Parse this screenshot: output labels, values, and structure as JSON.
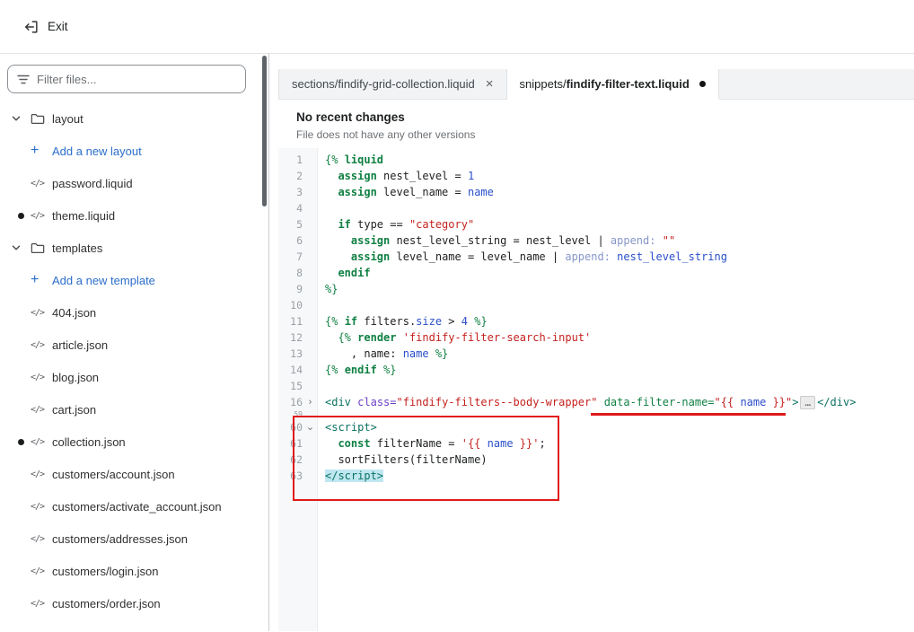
{
  "topbar": {
    "exit_label": "Exit"
  },
  "icons": {
    "close": "×",
    "unsaved_dot": "●",
    "add_plus": "+",
    "code_file": "</>",
    "fold_collapsed": "›",
    "fold_expanded": "⌄"
  },
  "sidebar": {
    "filter_placeholder": "Filter files...",
    "tree": [
      {
        "type": "folder",
        "label": "layout",
        "expanded": true
      },
      {
        "type": "add",
        "label": "Add a new layout"
      },
      {
        "type": "file",
        "label": "password.liquid",
        "modified": false
      },
      {
        "type": "file",
        "label": "theme.liquid",
        "modified": true
      },
      {
        "type": "folder",
        "label": "templates",
        "expanded": true
      },
      {
        "type": "add",
        "label": "Add a new template"
      },
      {
        "type": "file",
        "label": "404.json",
        "modified": false
      },
      {
        "type": "file",
        "label": "article.json",
        "modified": false
      },
      {
        "type": "file",
        "label": "blog.json",
        "modified": false
      },
      {
        "type": "file",
        "label": "cart.json",
        "modified": false
      },
      {
        "type": "file",
        "label": "collection.json",
        "modified": true
      },
      {
        "type": "file",
        "label": "customers/account.json",
        "modified": false
      },
      {
        "type": "file",
        "label": "customers/activate_account.json",
        "modified": false
      },
      {
        "type": "file",
        "label": "customers/addresses.json",
        "modified": false
      },
      {
        "type": "file",
        "label": "customers/login.json",
        "modified": false
      },
      {
        "type": "file",
        "label": "customers/order.json",
        "modified": false
      }
    ]
  },
  "tabs": [
    {
      "prefix": "sections/",
      "name": "findify-grid-collection.liquid",
      "active": false,
      "closeable": true,
      "dirty": false
    },
    {
      "prefix": "snippets/",
      "name": "findify-filter-text.liquid",
      "active": true,
      "closeable": false,
      "dirty": true
    }
  ],
  "editor": {
    "status_title": "No recent changes",
    "status_subtitle": "File does not have any other versions",
    "lines": [
      {
        "n": 1,
        "tokens": [
          [
            "g",
            "{% "
          ],
          [
            "kw",
            "liquid"
          ]
        ]
      },
      {
        "n": 2,
        "tokens": [
          [
            "p",
            "  "
          ],
          [
            "kw",
            "assign"
          ],
          [
            "p",
            " nest_level = "
          ],
          [
            "b",
            "1"
          ]
        ]
      },
      {
        "n": 3,
        "tokens": [
          [
            "p",
            "  "
          ],
          [
            "kw",
            "assign"
          ],
          [
            "p",
            " level_name = "
          ],
          [
            "b",
            "name"
          ]
        ]
      },
      {
        "n": 4,
        "tokens": []
      },
      {
        "n": 5,
        "tokens": [
          [
            "p",
            "  "
          ],
          [
            "kw",
            "if"
          ],
          [
            "p",
            " type == "
          ],
          [
            "s",
            "\"category\""
          ]
        ]
      },
      {
        "n": 6,
        "tokens": [
          [
            "p",
            "    "
          ],
          [
            "kw",
            "assign"
          ],
          [
            "p",
            " nest_level_string = nest_level | "
          ],
          [
            "f",
            "append:"
          ],
          [
            "p",
            " "
          ],
          [
            "s",
            "\"\""
          ]
        ]
      },
      {
        "n": 7,
        "tokens": [
          [
            "p",
            "    "
          ],
          [
            "kw",
            "assign"
          ],
          [
            "p",
            " level_name = level_name | "
          ],
          [
            "f",
            "append:"
          ],
          [
            "p",
            " "
          ],
          [
            "b",
            "nest_level_string"
          ]
        ]
      },
      {
        "n": 8,
        "tokens": [
          [
            "p",
            "  "
          ],
          [
            "kw",
            "endif"
          ]
        ]
      },
      {
        "n": 9,
        "tokens": [
          [
            "g",
            "%}"
          ]
        ]
      },
      {
        "n": 10,
        "tokens": []
      },
      {
        "n": 11,
        "tokens": [
          [
            "g",
            "{% "
          ],
          [
            "kw",
            "if"
          ],
          [
            "p",
            " filters."
          ],
          [
            "b",
            "size"
          ],
          [
            "p",
            " > "
          ],
          [
            "b",
            "4"
          ],
          [
            "g",
            " %}"
          ]
        ]
      },
      {
        "n": 12,
        "tokens": [
          [
            "p",
            "  "
          ],
          [
            "g",
            "{% "
          ],
          [
            "kw",
            "render"
          ],
          [
            "p",
            " "
          ],
          [
            "s",
            "'findify-filter-search-input'"
          ]
        ]
      },
      {
        "n": 13,
        "tokens": [
          [
            "p",
            "    , name: "
          ],
          [
            "b",
            "name"
          ],
          [
            "g",
            " %}"
          ]
        ]
      },
      {
        "n": 14,
        "tokens": [
          [
            "g",
            "{% "
          ],
          [
            "kw",
            "endif"
          ],
          [
            "g",
            " %}"
          ]
        ]
      },
      {
        "n": 15,
        "tokens": []
      },
      {
        "n": 16,
        "fold": "collapsed",
        "tokens": [
          [
            "tag",
            "<div"
          ],
          [
            "p",
            " "
          ],
          [
            "ap",
            "class="
          ],
          [
            "s",
            "\"findify-filters--body-wrapper\""
          ],
          [
            "p",
            " "
          ],
          [
            "ag",
            "data-filter-name="
          ],
          [
            "s",
            "\"{{ "
          ],
          [
            "b",
            "name"
          ],
          [
            "s",
            " }}\""
          ],
          [
            "tag",
            ">"
          ],
          [
            "fold",
            "…"
          ],
          [
            "tag",
            "</div>"
          ]
        ]
      },
      {
        "n": 59,
        "mini": true,
        "tokens": []
      },
      {
        "n": 60,
        "fold": "expanded",
        "tokens": [
          [
            "tag",
            "<script>"
          ]
        ]
      },
      {
        "n": 61,
        "tokens": [
          [
            "p",
            "  "
          ],
          [
            "kw",
            "const"
          ],
          [
            "p",
            " filterName = "
          ],
          [
            "s",
            "'{{ "
          ],
          [
            "b",
            "name"
          ],
          [
            "s",
            " }}'"
          ],
          [
            "p",
            ";"
          ]
        ]
      },
      {
        "n": 62,
        "tokens": [
          [
            "p",
            "  sortFilters(filterName)"
          ]
        ]
      },
      {
        "n": 63,
        "tokens": [
          [
            "hl",
            "</script>"
          ]
        ]
      }
    ]
  },
  "annotations": {
    "color": "#e01a1a"
  }
}
